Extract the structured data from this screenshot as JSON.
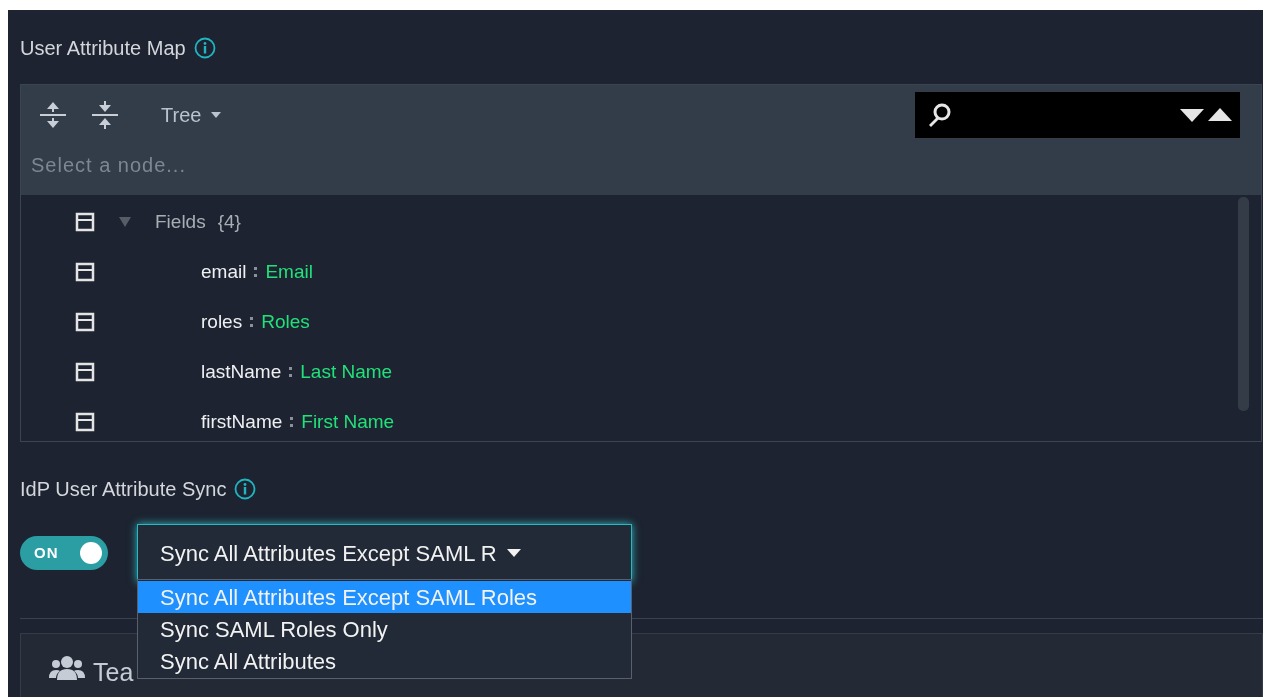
{
  "attribute_map": {
    "title": "User Attribute Map",
    "toolbar": {
      "mode": "Tree"
    },
    "breadcrumb_placeholder": "Select a node...",
    "tree": [
      {
        "label": "Fields",
        "count": "{4}",
        "expanded": true,
        "children": [
          {
            "key": "email",
            "value": "Email"
          },
          {
            "key": "roles",
            "value": "Roles"
          },
          {
            "key": "lastName",
            "value": "Last Name"
          },
          {
            "key": "firstName",
            "value": "First Name"
          }
        ]
      }
    ]
  },
  "sync": {
    "title": "IdP User Attribute Sync",
    "toggle": {
      "label": "ON",
      "on": true
    },
    "select": {
      "value": "Sync All Attributes Except SAML R",
      "expanded": true,
      "options": [
        {
          "label": "Sync All Attributes Except SAML Roles",
          "selected": true
        },
        {
          "label": "Sync SAML Roles Only",
          "selected": false
        },
        {
          "label": "Sync All Attributes",
          "selected": false
        }
      ]
    }
  },
  "section": {
    "title": "Tea"
  }
}
